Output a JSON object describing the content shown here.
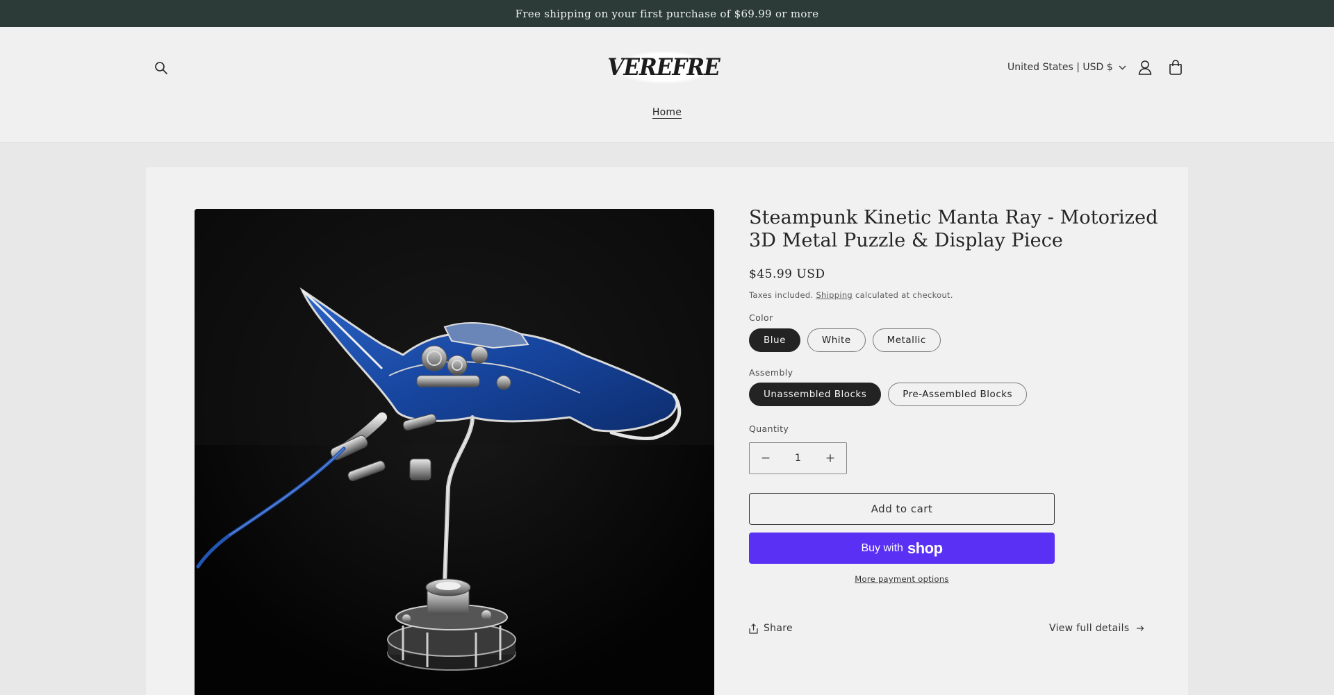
{
  "announcement": {
    "text": "Free shipping on your first purchase of $69.99 or more"
  },
  "header": {
    "logo_text": "VEREFRE",
    "country_selector": "United States | USD $",
    "nav": {
      "home": "Home"
    }
  },
  "product": {
    "title": "Steampunk Kinetic Manta Ray - Motorized 3D Metal Puzzle & Display Piece",
    "price": "$45.99 USD",
    "tax_note_prefix": "Taxes included.",
    "tax_note_link": "Shipping",
    "tax_note_suffix": "calculated at checkout.",
    "options": {
      "color": {
        "label": "Color",
        "values": [
          "Blue",
          "White",
          "Metallic"
        ],
        "selected": "Blue"
      },
      "assembly": {
        "label": "Assembly",
        "values": [
          "Unassembled Blocks",
          "Pre-Assembled Blocks"
        ],
        "selected": "Unassembled Blocks"
      }
    },
    "quantity": {
      "label": "Quantity",
      "value": "1",
      "decrease": "−",
      "increase": "+"
    },
    "add_to_cart": "Add to cart",
    "buy_with": "Buy with",
    "buy_brand": "shop",
    "more_payment_options": "More payment options",
    "share": "Share",
    "view_full_details": "View full details"
  },
  "colors": {
    "announcement_bg": "#2c3b38",
    "shop_pay": "#5a31f4",
    "selected_pill": "#232323",
    "page_bg": "#e9e8e9"
  },
  "icons": [
    "search-icon",
    "chevron-down-icon",
    "account-icon",
    "cart-icon",
    "minus-icon",
    "plus-icon",
    "share-icon",
    "arrow-right-icon"
  ]
}
